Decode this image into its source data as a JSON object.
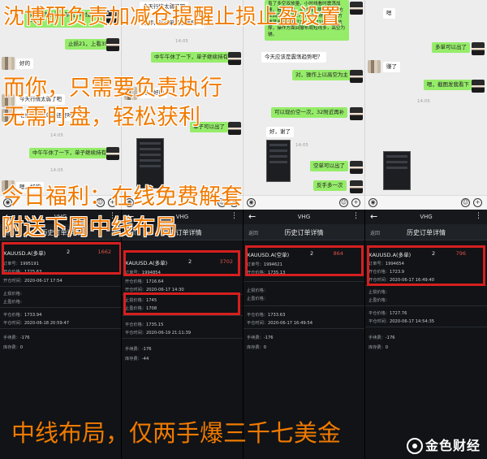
{
  "captions": {
    "line1": "沈博研负责加减仓提醒止损止盈设置",
    "line2": "而你，只需要负责执行",
    "line3": "无需盯盘，轻松获利",
    "line4": "今日福利：在线免费解套",
    "line5": "附送下周中线布局",
    "line6": "中线布局，仅两手爆三千七美金"
  },
  "watermark": "金色财经",
  "chat1": {
    "msgs": [
      "今天震荡偏弱，早盘25附近多一次",
      "止损21，上看35",
      "好的",
      "今天行情太弱了吧",
      "老师，这这单子还要吗？",
      "中午午休了一下，单子继续持有",
      "嗯，好的"
    ],
    "times": [
      "14:05",
      "14:05"
    ]
  },
  "chat2": {
    "msgs": [
      "今天行情太弱了吧",
      "老师，这这单子还要吗？",
      "中午午休了一下，单子继续持有",
      "嗯，好的",
      "单子可以出了"
    ],
    "times": [
      "14:05"
    ]
  },
  "chat3": {
    "msgs": [
      "直了多空双放量，小时线看时震荡加速，看多目线，小时线走势来看，1方五回落点关注1735-1740附近，下方震荡支撑点关注1716-1718点附近支撑，操作方面回撤布局短线多，高空为辅。",
      "今天应该是震荡趋势吧？",
      "对，操作上以高空为主",
      "可以现价空一次，32附近再补",
      "好，谢了",
      "空单可以出了",
      "反手多一次"
    ],
    "times": [
      "14:05"
    ]
  },
  "chat4": {
    "msgs": [
      "嗯",
      "多单可以出了",
      "赚了",
      "嗯，截图发我看下"
    ],
    "times": [
      "14:05"
    ]
  },
  "phones": {
    "app_title": "VHG",
    "back_label": "返回",
    "sub_title": "历史订单详情",
    "p1": {
      "symbol": "XAUUSD.A(多单)",
      "lots": "2",
      "profit": "1662",
      "order_no": "1995191",
      "open_price": "1725.63",
      "open_time": "2020-06-17 17:54",
      "sl": "",
      "tp": "",
      "close_price": "1733.94",
      "close_time": "2020-06-18 20:59:47",
      "fee": "-176",
      "swap": "0"
    },
    "p2": {
      "symbol": "XAUUSD.A(多单)",
      "lots": "2",
      "profit": "3702",
      "order_no": "1994854",
      "open_price": "1716.64",
      "open_time": "2020-06-17 14:30",
      "sl": "1745",
      "tp": "1708",
      "close_price": "1735.15",
      "close_time": "2020-06-19 21:11:39",
      "fee": "-176",
      "swap": "-44"
    },
    "p3": {
      "symbol": "XAUUSD.A(空单)",
      "lots": "2",
      "profit": "864",
      "order_no": "1994621",
      "open_price": "1735.13",
      "open_time": "2020-06-17",
      "sl": "",
      "tp": "",
      "close_price": "1733.63",
      "close_time": "2020-06-17 16:49:54",
      "fee": "-176",
      "swap": "0"
    },
    "p4": {
      "symbol": "XAUUSD.A(多单)",
      "lots": "2",
      "profit": "796",
      "order_no": "1994654",
      "open_price": "1723.9",
      "open_time": "2020-06-17 16:49:40",
      "sl": "",
      "tp": "",
      "close_price": "1727.76",
      "close_time": "2020-06-17 14:54:35",
      "fee": "-176",
      "swap": "0"
    },
    "labels": {
      "order_no": "订单号：",
      "open_price": "开仓价格：",
      "open_time": "开仓时间：",
      "sl": "止损价格：",
      "tp": "止盈价格：",
      "close_price": "平仓价格：",
      "close_time": "平仓时间：",
      "fee": "手续费：",
      "swap": "库存费："
    }
  },
  "colors": {
    "caption": "#f07a00",
    "highlight": "#d61f1f",
    "bubble_green": "#95ec69",
    "profit": "#e0504a"
  }
}
